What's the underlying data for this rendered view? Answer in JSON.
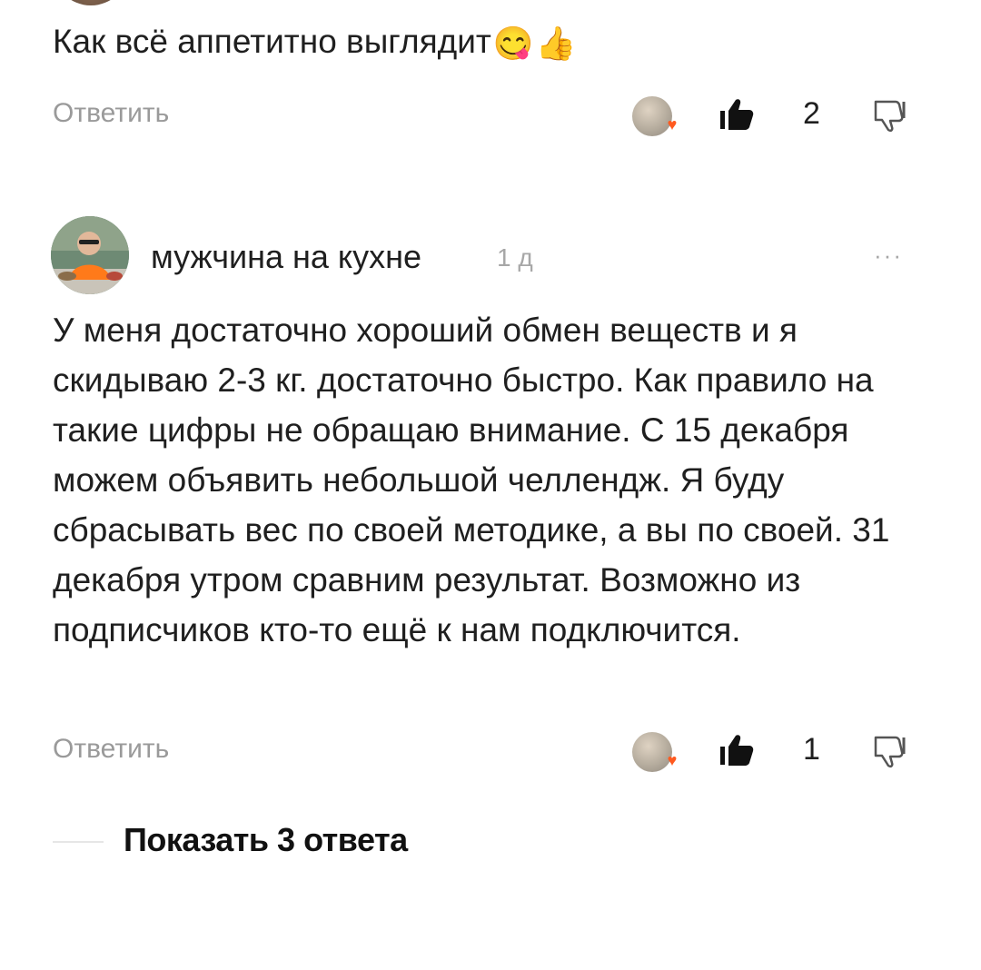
{
  "comment1": {
    "text": "Как всё аппетитно выглядит",
    "emojis": [
      "😋",
      "👍"
    ],
    "reply_label": "Ответить",
    "like_count": "2"
  },
  "comment2": {
    "author": "мужчина на кухне",
    "time": "1 д",
    "more": "···",
    "text": "У меня достаточно хороший обмен веществ и я скидываю 2-3 кг. достаточно быстро. Как правило на такие цифры не обращаю внимание. С 15 декабря можем объявить небольшой челлендж. Я буду сбрасывать вес по своей методике, а вы по своей. 31 декабря утром сравним результат. Возможно из подписчиков кто-то ещё к нам подключится.",
    "reply_label": "Ответить",
    "like_count": "1"
  },
  "show_replies": "Показать 3 ответа",
  "icons": {
    "like": "thumbs-up-icon",
    "dislike": "thumbs-down-icon",
    "heart": "heart-icon",
    "more": "more-dots-icon"
  },
  "colors": {
    "muted": "#9a9a9a",
    "heart": "#ff5a1f",
    "text": "#1f1f1f"
  }
}
